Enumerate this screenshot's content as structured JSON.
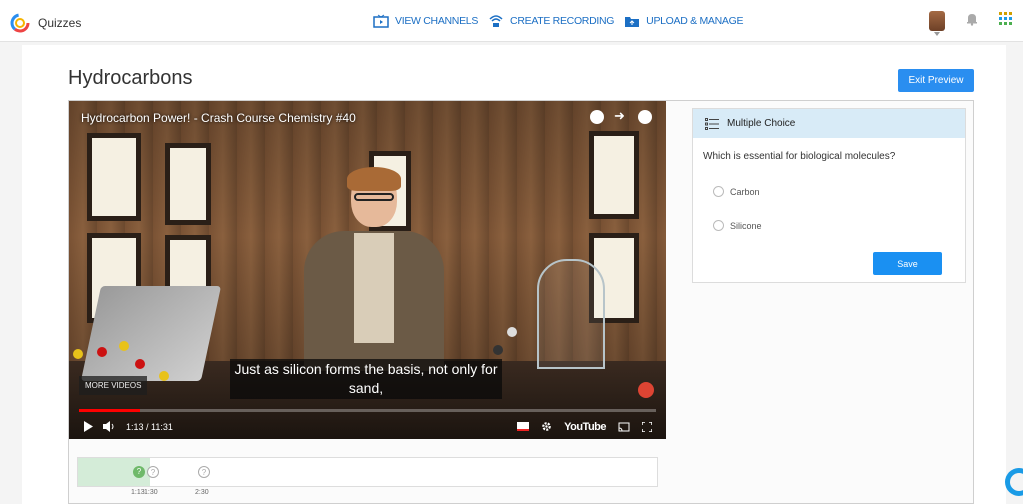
{
  "app": {
    "brand": "Quizzes"
  },
  "nav": {
    "view_channels": "VIEW CHANNELS",
    "create_recording": "CREATE RECORDING",
    "upload_manage": "UPLOAD & MANAGE"
  },
  "page": {
    "title": "Hydrocarbons",
    "exit_preview": "Exit Preview"
  },
  "video": {
    "title": "Hydrocarbon Power! - Crash Course Chemistry #40",
    "subtitle": "Just as silicon forms the basis, not only for sand,",
    "more_videos": "MORE VIDEOS",
    "time": "1:13 / 11:31",
    "progress": 0.106,
    "platform": "YouTube"
  },
  "quiz": {
    "type": "Multiple Choice",
    "question": "Which is essential for biological molecules?",
    "options": [
      "Carbon",
      "Silicone"
    ],
    "save": "Save"
  },
  "timeline": {
    "markers": [
      {
        "label": "1:13",
        "state": "done",
        "symbol": "?"
      },
      {
        "label": "1:30",
        "state": "todo",
        "symbol": "?"
      },
      {
        "label": "2:30",
        "state": "todo",
        "symbol": "?"
      }
    ]
  },
  "colors": {
    "accent": "#2a8ef0",
    "nav_link": "#1c6fc4",
    "quiz_header": "#d8ebf7",
    "timeline_done": "#6fb96a"
  }
}
